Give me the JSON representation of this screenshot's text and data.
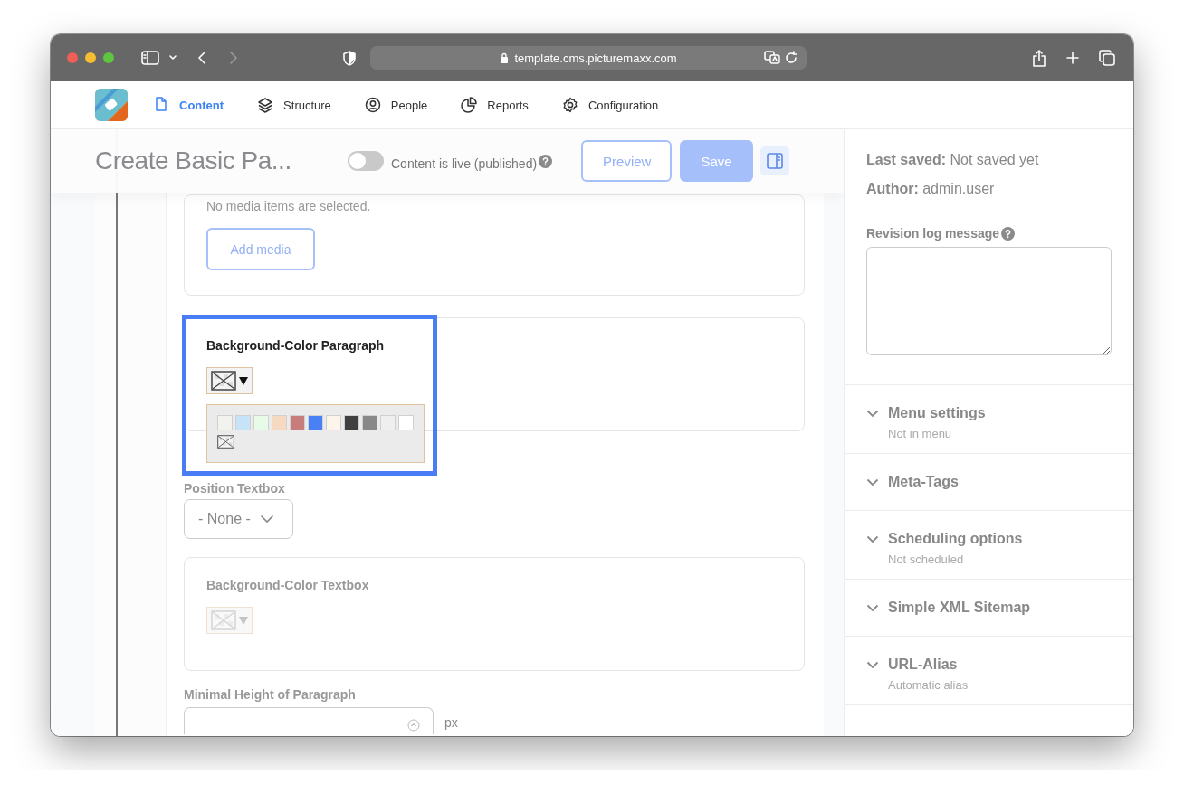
{
  "browser": {
    "url": "template.cms.picturemaxx.com"
  },
  "nav": [
    {
      "label": "Content",
      "selected": true
    },
    {
      "label": "Structure",
      "selected": false
    },
    {
      "label": "People",
      "selected": false
    },
    {
      "label": "Reports",
      "selected": false
    },
    {
      "label": "Configuration",
      "selected": false
    }
  ],
  "header": {
    "title": "Create Basic Pa...",
    "toggle": {
      "label": "Content is live (published)",
      "on": false
    },
    "buttons": [
      {
        "label": "Preview",
        "kind": "outline"
      },
      {
        "label": "Save",
        "kind": "primary"
      }
    ]
  },
  "media": {
    "message": "No media items are selected.",
    "button": "Add media"
  },
  "bg_paragraph": {
    "label": "Background-Color Paragraph",
    "highlighted": true,
    "disabled": false,
    "open": true,
    "swatches": [
      {
        "kind": "color",
        "color": "#f2f2ee"
      },
      {
        "kind": "color",
        "color": "#c6e3f7"
      },
      {
        "kind": "color",
        "color": "#e8fbe9"
      },
      {
        "kind": "color",
        "color": "#f5d9c0"
      },
      {
        "kind": "color",
        "color": "#c77d7b"
      },
      {
        "kind": "color",
        "color": "#4a80f5"
      },
      {
        "kind": "color",
        "color": "#fdf5ec"
      },
      {
        "kind": "color",
        "color": "#404040"
      },
      {
        "kind": "color",
        "color": "#888888"
      },
      {
        "kind": "color",
        "color": "#efefef"
      },
      {
        "kind": "color",
        "color": "#ffffff"
      },
      {
        "kind": "none"
      }
    ]
  },
  "position": {
    "label": "Position Textbox",
    "value": "- None -"
  },
  "bg_textbox": {
    "label": "Background-Color Textbox",
    "disabled": true
  },
  "min_height": {
    "label": "Minimal Height of Paragraph",
    "unit": "px"
  },
  "sidebar": {
    "meta": [
      {
        "label": "Last saved:",
        "value": "Not saved yet"
      },
      {
        "label": "Author:",
        "value": "admin.user"
      }
    ],
    "revision_label": "Revision log message",
    "sections": [
      {
        "title": "Menu settings",
        "summary": "Not in menu"
      },
      {
        "title": "Meta-Tags"
      },
      {
        "title": "Scheduling options",
        "summary": "Not scheduled"
      },
      {
        "title": "Simple XML Sitemap"
      },
      {
        "title": "URL-Alias",
        "summary": "Automatic alias"
      }
    ]
  }
}
